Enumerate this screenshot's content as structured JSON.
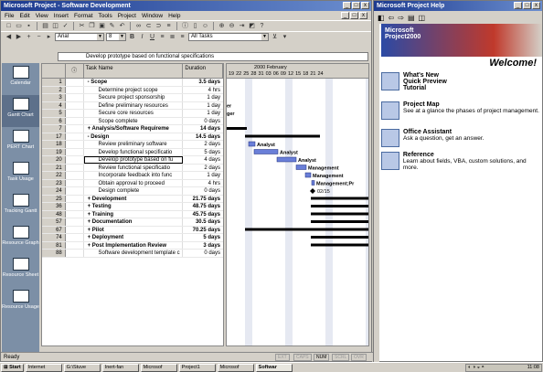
{
  "project_window": {
    "title": "Microsoft Project - Software Development",
    "menu": [
      "File",
      "Edit",
      "View",
      "Insert",
      "Format",
      "Tools",
      "Project",
      "Window",
      "Help"
    ],
    "font_name": "Arial",
    "font_size": "8",
    "filter": "All Tasks",
    "entry_text": "Develop prototype based on functional specifications"
  },
  "view_bar": [
    "Calendar",
    "Gantt Chart",
    "PERT Chart",
    "Task Usage",
    "Tracking Gantt",
    "Resource Graph",
    "Resource Sheet",
    "Resource Usage"
  ],
  "sheet": {
    "col_name": "Task Name",
    "col_duration": "Duration",
    "rows": [
      {
        "id": "1",
        "name": "- Scope",
        "dur": "3.5 days",
        "bold": true,
        "indent": 0
      },
      {
        "id": "2",
        "name": "Determine project scope",
        "dur": "4 hrs",
        "bold": false,
        "indent": 1
      },
      {
        "id": "3",
        "name": "Secure project sponsorship",
        "dur": "1 day",
        "bold": false,
        "indent": 1
      },
      {
        "id": "4",
        "name": "Define preliminary resources",
        "dur": "1 day",
        "bold": false,
        "indent": 1
      },
      {
        "id": "5",
        "name": "Secure core resources",
        "dur": "1 day",
        "bold": false,
        "indent": 1
      },
      {
        "id": "6",
        "name": "Scope complete",
        "dur": "0 days",
        "bold": false,
        "indent": 1
      },
      {
        "id": "7",
        "name": "+ Analysis/Software Requireme",
        "dur": "14 days",
        "bold": true,
        "indent": 0
      },
      {
        "id": "17",
        "name": "- Design",
        "dur": "14.5 days",
        "bold": true,
        "indent": 0
      },
      {
        "id": "18",
        "name": "Review preliminary software",
        "dur": "2 days",
        "bold": false,
        "indent": 1
      },
      {
        "id": "19",
        "name": "Develop functional specificatio",
        "dur": "5 days",
        "bold": false,
        "indent": 1
      },
      {
        "id": "20",
        "name": "Develop prototype based on fu",
        "dur": "4 days",
        "bold": false,
        "indent": 1,
        "selected": true
      },
      {
        "id": "21",
        "name": "Review functional specificatio",
        "dur": "2 days",
        "bold": false,
        "indent": 1
      },
      {
        "id": "22",
        "name": "Incorporate feedback into func",
        "dur": "1 day",
        "bold": false,
        "indent": 1
      },
      {
        "id": "23",
        "name": "Obtain approval to proceed",
        "dur": "4 hrs",
        "bold": false,
        "indent": 1
      },
      {
        "id": "24",
        "name": "Design complete",
        "dur": "0 days",
        "bold": false,
        "indent": 1
      },
      {
        "id": "25",
        "name": "+ Development",
        "dur": "21.75 days",
        "bold": true,
        "indent": 0
      },
      {
        "id": "36",
        "name": "+ Testing",
        "dur": "48.75 days",
        "bold": true,
        "indent": 0
      },
      {
        "id": "48",
        "name": "+ Training",
        "dur": "45.75 days",
        "bold": true,
        "indent": 0
      },
      {
        "id": "57",
        "name": "+ Documentation",
        "dur": "30.5 days",
        "bold": true,
        "indent": 0
      },
      {
        "id": "67",
        "name": "+ Pilot",
        "dur": "70.25 days",
        "bold": true,
        "indent": 0
      },
      {
        "id": "74",
        "name": "+ Deployment",
        "dur": "5 days",
        "bold": true,
        "indent": 0
      },
      {
        "id": "81",
        "name": "+ Post Implementation Review",
        "dur": "3 days",
        "bold": true,
        "indent": 0
      },
      {
        "id": "88",
        "name": "Software development template c",
        "dur": "0 days",
        "bold": false,
        "indent": 1
      }
    ]
  },
  "gantt": {
    "month_label": "2000 February",
    "day_labels": [
      "19",
      "22",
      "25",
      "28",
      "31",
      "03",
      "06",
      "09",
      "12",
      "15",
      "18",
      "21",
      "24"
    ],
    "bar_labels": [
      "Analyst",
      "Analyst",
      "Analyst",
      "Management",
      "Management",
      "Management;Pr",
      "02/15"
    ],
    "side_labels": [
      "er",
      "ger"
    ]
  },
  "status": {
    "ready": "Ready",
    "indicators": [
      "EXT",
      "CAPS",
      "NUM",
      "SCRL",
      "OVR"
    ]
  },
  "help_window": {
    "title": "Microsoft Project Help",
    "brand_line1": "Microsoft",
    "brand_line2": "Project2000",
    "welcome": "Welcome!",
    "items": [
      {
        "title": "What's New",
        "desc": "",
        "extra": [
          "Quick Preview",
          "Tutorial"
        ]
      },
      {
        "title": "Project Map",
        "desc": "See at a glance the phases of project management."
      },
      {
        "title": "Office Assistant",
        "desc": "Ask a question, get an answer."
      },
      {
        "title": "Reference",
        "desc": "Learn about fields, VBA, custom solutions, and more."
      }
    ]
  },
  "taskbar": {
    "start": "Start",
    "buttons": [
      "Internet",
      "G:\\Stuve",
      "Inert-fan",
      "Microsof",
      "Project1",
      "Microsof",
      "Softwar"
    ],
    "clock": "11:08"
  }
}
